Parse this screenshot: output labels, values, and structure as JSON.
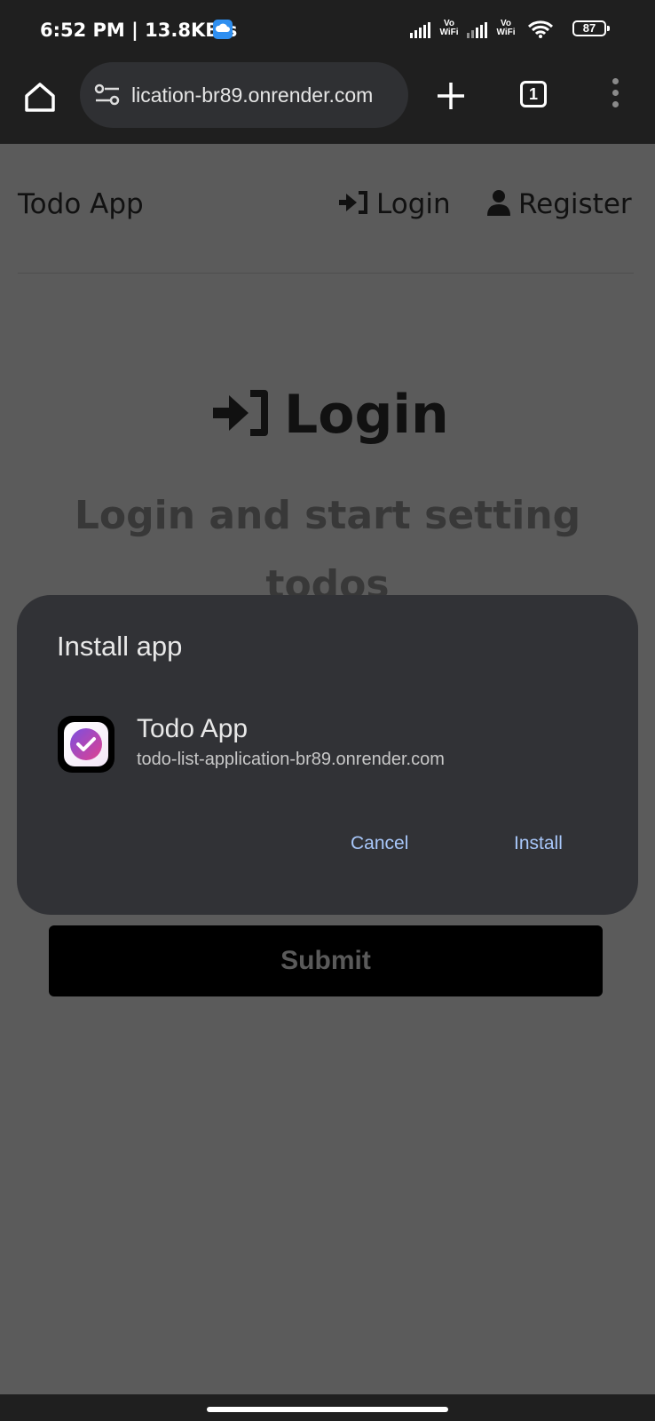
{
  "status_bar": {
    "time_speed": "6:52 PM | 13.8KB/s",
    "vowifi_1": "Vo WiFi",
    "vowifi_2": "Vo WiFi",
    "battery": "87"
  },
  "browser": {
    "url": "lication-br89.onrender.com",
    "tab_count": "1"
  },
  "page": {
    "brand": "Todo App",
    "nav_login": "Login",
    "nav_register": "Register",
    "heading": "Login",
    "subheading": "Login and start setting todos",
    "submit": "Submit"
  },
  "install_dialog": {
    "title": "Install app",
    "app_name": "Todo App",
    "app_url": "todo-list-application-br89.onrender.com",
    "cancel": "Cancel",
    "install": "Install"
  },
  "colors": {
    "dialog_bg": "#313236",
    "accent": "#a8c7fa",
    "page_overlay": "#5b5b5b"
  }
}
